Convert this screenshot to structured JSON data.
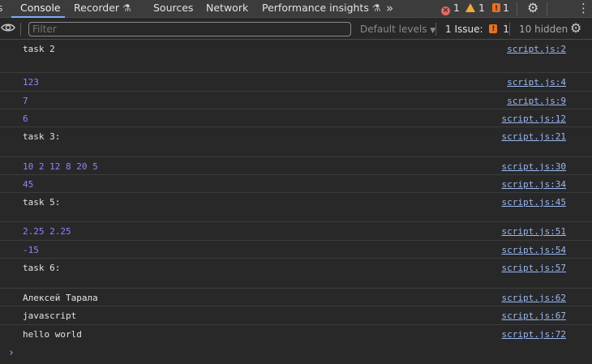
{
  "tabs": [
    {
      "label": "Console"
    },
    {
      "label": "Recorder"
    },
    {
      "label": "Sources"
    },
    {
      "label": "Network"
    },
    {
      "label": "Performance insights"
    }
  ],
  "counters": {
    "errors": "1",
    "warnings": "1",
    "issues": "1"
  },
  "toolbar": {
    "filter_placeholder": "Filter",
    "levels": "Default levels",
    "issues": "1 Issue:",
    "issues_count": "1",
    "hidden": "10 hidden"
  },
  "console": [
    {
      "text": "task 2",
      "source": "script.js:2",
      "kind": "text"
    },
    {
      "text": "123",
      "source": "script.js:4",
      "kind": "num"
    },
    {
      "text": "7",
      "source": "script.js:9",
      "kind": "num"
    },
    {
      "text": "6",
      "source": "script.js:12",
      "kind": "num"
    },
    {
      "text": "task 3:",
      "source": "script.js:21",
      "kind": "text"
    },
    {
      "text": "10 2 12 8 20 5",
      "source": "script.js:30",
      "kind": "num"
    },
    {
      "text": "45",
      "source": "script.js:34",
      "kind": "num"
    },
    {
      "text": "task 5:",
      "source": "script.js:45",
      "kind": "text"
    },
    {
      "text": "2.25 2.25",
      "source": "script.js:51",
      "kind": "num"
    },
    {
      "text": "-15",
      "source": "script.js:54",
      "kind": "num"
    },
    {
      "text": "task 6:",
      "source": "script.js:57",
      "kind": "text"
    },
    {
      "text": "Алексей Тарала",
      "source": "script.js:62",
      "kind": "text"
    },
    {
      "text": "javascript",
      "source": "script.js:67",
      "kind": "text"
    },
    {
      "text": "hello world",
      "source": "script.js:72",
      "kind": "text"
    }
  ],
  "colors": {
    "accent": "#7cacf8",
    "number": "#9980ff",
    "link": "#9ab8f0",
    "error": "#e46962",
    "warning": "#f2a93b"
  },
  "icons": [
    "eye-icon",
    "gear-icon",
    "kebab-icon",
    "chevron-double-right-icon",
    "flask-icon",
    "error-icon",
    "warning-icon",
    "issue-icon",
    "prompt-chevron-icon"
  ]
}
